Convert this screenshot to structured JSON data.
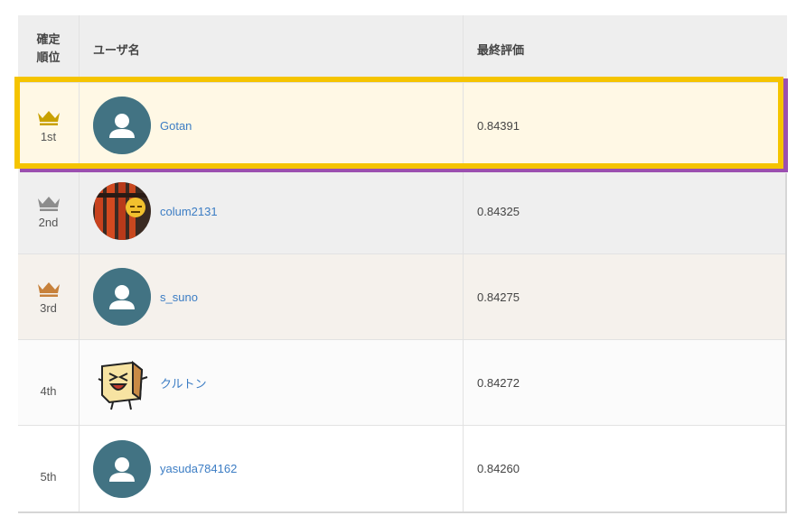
{
  "header": {
    "rank_label_line1": "確定",
    "rank_label_line2": "順位",
    "user_label": "ユーザ名",
    "score_label": "最終評価"
  },
  "rows": [
    {
      "rank": "1st",
      "crown": "gold-crown-icon",
      "crown_color": "#c9a100",
      "user": "Gotan",
      "avatar": "default-avatar",
      "score": "0.84391"
    },
    {
      "rank": "2nd",
      "crown": "silver-crown-icon",
      "crown_color": "#8c8c8c",
      "user": "colum2131",
      "avatar": "torii-photo-avatar",
      "score": "0.84325"
    },
    {
      "rank": "3rd",
      "crown": "bronze-crown-icon",
      "crown_color": "#c7813b",
      "user": "s_suno",
      "avatar": "default-avatar",
      "score": "0.84275"
    },
    {
      "rank": "4th",
      "crown": null,
      "user": "クルトン",
      "avatar": "crouton-character-avatar",
      "score": "0.84272"
    },
    {
      "rank": "5th",
      "crown": null,
      "user": "yasuda784162",
      "avatar": "default-avatar",
      "score": "0.84260"
    }
  ],
  "colors": {
    "highlight": "#f5c400",
    "link": "#3c7dc4",
    "avatar_bg": "#3e6f80"
  }
}
